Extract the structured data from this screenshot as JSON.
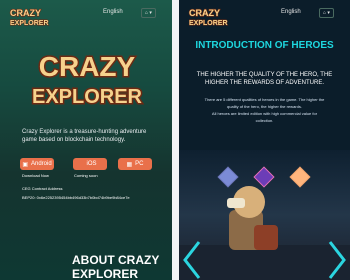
{
  "left": {
    "logo_text": "CRAZY EXPLORER",
    "lang": "English",
    "home_icon": "home-icon",
    "title_line1": "CRAZY",
    "title_line2": "EXPLORER",
    "intro": "Crazy Explorer is a treasure-hunting adventure game based on blockchain technology.",
    "buttons": [
      {
        "label": "Android",
        "icon": "android-icon"
      },
      {
        "label": "iOS",
        "icon": "apple-icon"
      },
      {
        "label": "PC",
        "icon": "windows-icon"
      }
    ],
    "download_now": "Download Now",
    "coming_soon": "Coming soon",
    "contract_label": "CEG Contract Address",
    "contract_address": "BEP20: 0x6e2252395454bb496d33b7b0bd74b9be9b84ce7e",
    "about_title_1": "ABOUT CRAZY",
    "about_title_2": "EXPLORER"
  },
  "right": {
    "logo_text": "CRAZY EXPLORER",
    "lang": "English",
    "home_icon": "home-icon",
    "section_title": "INTRODUCTION OF HEROES",
    "subtitle_1": "THE HIGHER THE QUALITY OF THE HERO, THE",
    "subtitle_2": "HIGHER THE REWARDS OF ADVENTURE.",
    "desc_1": "There are 5 different qualities of heroes in the game. The higher the",
    "desc_2": "quality of the hero, the higher the rewards.",
    "desc_3": "All heroes are limited edition with high commercial value for",
    "desc_4": "collection."
  },
  "colors": {
    "accent": "#e9704a",
    "cyan": "#1ed7df",
    "logo_fill": "#f6d28d",
    "logo_outline": "#6b2a13"
  }
}
